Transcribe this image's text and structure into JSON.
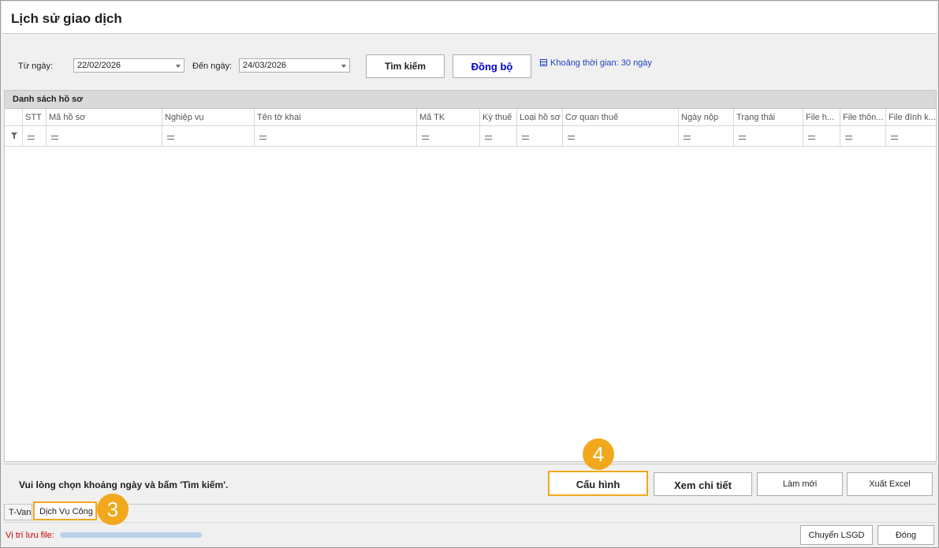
{
  "window": {
    "title": "Lịch sử giao dịch"
  },
  "filter": {
    "from_label": "Từ ngày:",
    "from_value": "22/02/2026",
    "to_label": "Đến ngày:",
    "to_value": "24/03/2026",
    "search_button": "Tìm kiếm",
    "sync_button": "Đồng bộ",
    "range_note": "Khoảng thời gian: 30 ngày"
  },
  "grid": {
    "caption": "Danh sách hồ sơ",
    "columns": [
      "STT",
      "Mã hồ sơ",
      "Nghiệp vụ",
      "Tên tờ khai",
      "Mã TK",
      "Kỳ thuế",
      "Loại hồ sơ",
      "Cơ quan thuế",
      "Ngày nộp",
      "Trạng thái",
      "File h...",
      "File thôn...",
      "File đính k..."
    ]
  },
  "footer": {
    "message": "Vui lòng chọn khoảng ngày và bấm 'Tìm kiếm'.",
    "buttons": {
      "config": "Cấu hình",
      "detail": "Xem chi tiết",
      "refresh": "Làm mới",
      "export": "Xuất Excel"
    }
  },
  "tabs": [
    "T-Van",
    "Dịch Vụ Công"
  ],
  "bottom": {
    "save_label": "Vị trí lưu file:",
    "transfer_button": "Chuyển LSGD",
    "close_button": "Đóng"
  },
  "annotations": {
    "tab_step": "3",
    "config_step": "4"
  },
  "colors": {
    "highlight": "#f2a81d",
    "sync_text": "#0000cc",
    "range_note": "#1a3fbf",
    "save_label": "#cc0000"
  }
}
